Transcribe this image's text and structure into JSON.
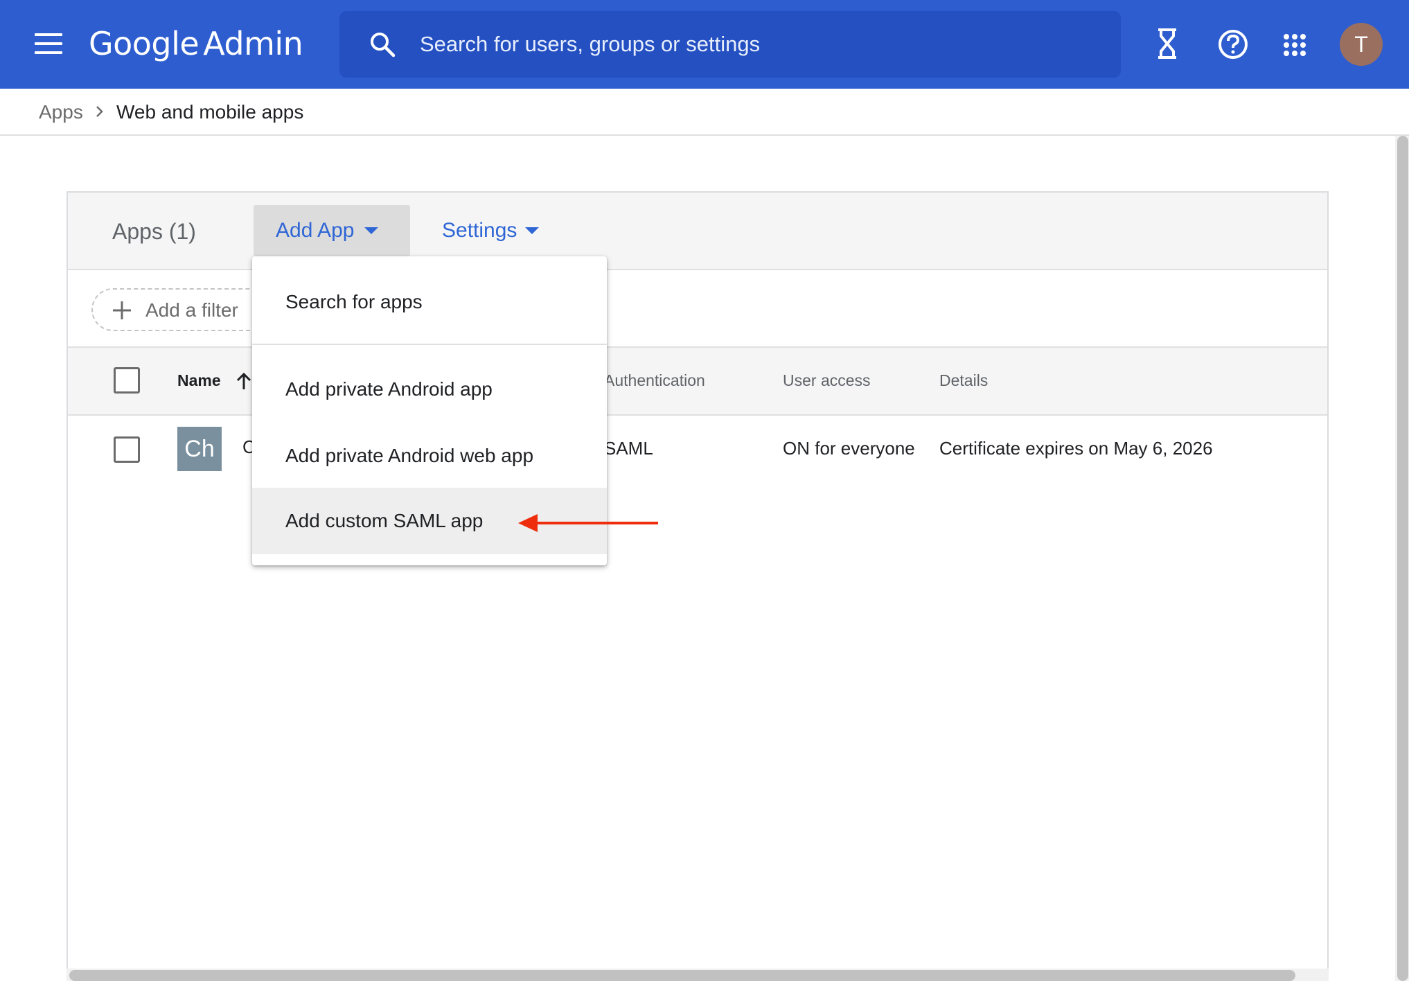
{
  "header": {
    "logo_google": "Google",
    "logo_admin": "Admin",
    "search_placeholder": "Search for users, groups or settings",
    "icons": [
      "menu-icon",
      "search-icon",
      "hourglass-icon",
      "help-icon",
      "apps-grid-icon"
    ],
    "avatar_initial": "T",
    "avatar_color": "#9b6f5f",
    "accent": "#2d5dcf"
  },
  "breadcrumb": {
    "root": "Apps",
    "current": "Web and mobile apps"
  },
  "toolbar": {
    "title": "Apps (1)",
    "add_app_label": "Add App",
    "settings_label": "Settings"
  },
  "filter": {
    "add_filter_label": "Add a filter"
  },
  "table": {
    "columns": {
      "name": "Name",
      "authentication": "Authentication",
      "user_access": "User access",
      "details": "Details"
    },
    "rows": [
      {
        "tile": "Ch",
        "name_visible": "C",
        "authentication": "SAML",
        "user_access": "ON for everyone",
        "details": "Certificate expires on May 6, 2026"
      }
    ]
  },
  "dropdown": {
    "items": [
      "Search for apps",
      "Add private Android app",
      "Add private Android web app",
      "Add custom SAML app"
    ],
    "highlighted_index": 3
  },
  "annotation": {
    "arrow_color": "#ee2d0d"
  }
}
